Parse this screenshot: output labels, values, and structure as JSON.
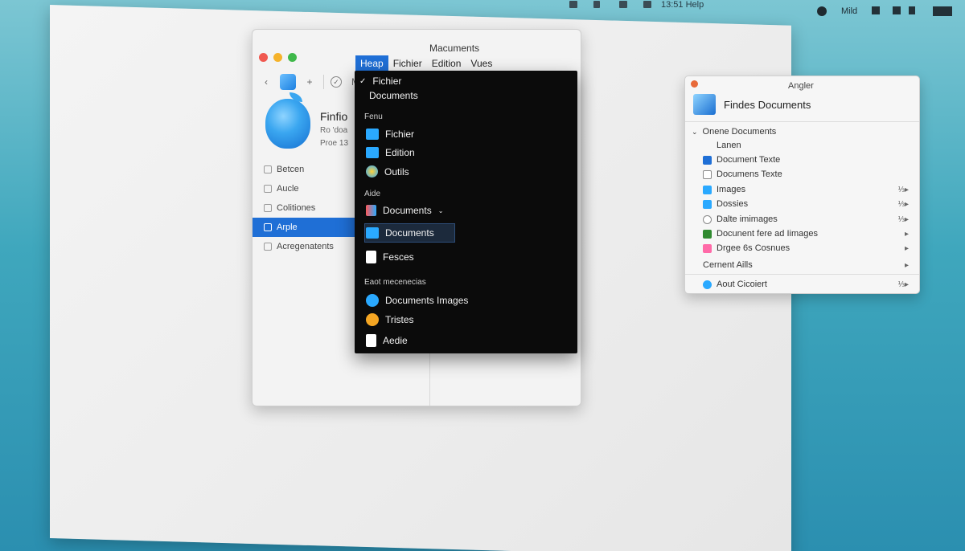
{
  "menubar": {
    "time_help": "13:51 Help",
    "status_a": "Mild"
  },
  "main_window": {
    "title": "Macuments",
    "menu": [
      "Heap",
      "Fichier",
      "Edition",
      "Vues"
    ],
    "header_title": "Finfio",
    "header_sub1": "Ro 'doa",
    "header_sub2": "Proe 13",
    "sidebar": [
      {
        "label": "Betcen",
        "selected": false
      },
      {
        "label": "Aucle",
        "selected": false
      },
      {
        "label": "Colitiones",
        "selected": false
      },
      {
        "label": "Arple",
        "selected": true
      },
      {
        "label": "Acregenatents",
        "selected": false
      }
    ]
  },
  "dropdown": {
    "top_items": [
      "Fichier",
      "Documents"
    ],
    "section1_label": "Fenu",
    "section1": [
      "Fichier",
      "Edition",
      "Outils"
    ],
    "section2_label": "Aide",
    "section2": [
      "Documents",
      "Documents",
      "Fesces"
    ],
    "section3_label": "Eaot mecenecias",
    "section3": [
      "Documents Images",
      "Tristes",
      "Aedie"
    ],
    "colors": {
      "folder": "#2aa9ff",
      "accent": "#1f6fd6"
    }
  },
  "right_window": {
    "title": "Angler",
    "header": "Findes Documents",
    "section_label": "Onene Documents",
    "rows": [
      {
        "label": "Lanen",
        "icon": "none"
      },
      {
        "label": "Document Texte",
        "icon": "pen-icon"
      },
      {
        "label": "Documens Texte",
        "icon": "doc-icon"
      },
      {
        "label": "Images",
        "icon": "image-icon"
      },
      {
        "label": "Dossies",
        "icon": "folder-icon"
      },
      {
        "label": "Dalte imimages",
        "icon": "gear-icon"
      },
      {
        "label": "Docunent fere ad Iimages",
        "icon": "box-icon"
      },
      {
        "label": "Drgee 6s Cosnues",
        "icon": "pink-icon"
      }
    ],
    "arrows": [
      "⅓▸",
      "⅓▸",
      "⅓▸",
      "▸",
      "▸"
    ],
    "footer1": "Cernent Aills",
    "footer2": "Aout Cicoiert",
    "footer2_arrow": "⅓▸"
  }
}
